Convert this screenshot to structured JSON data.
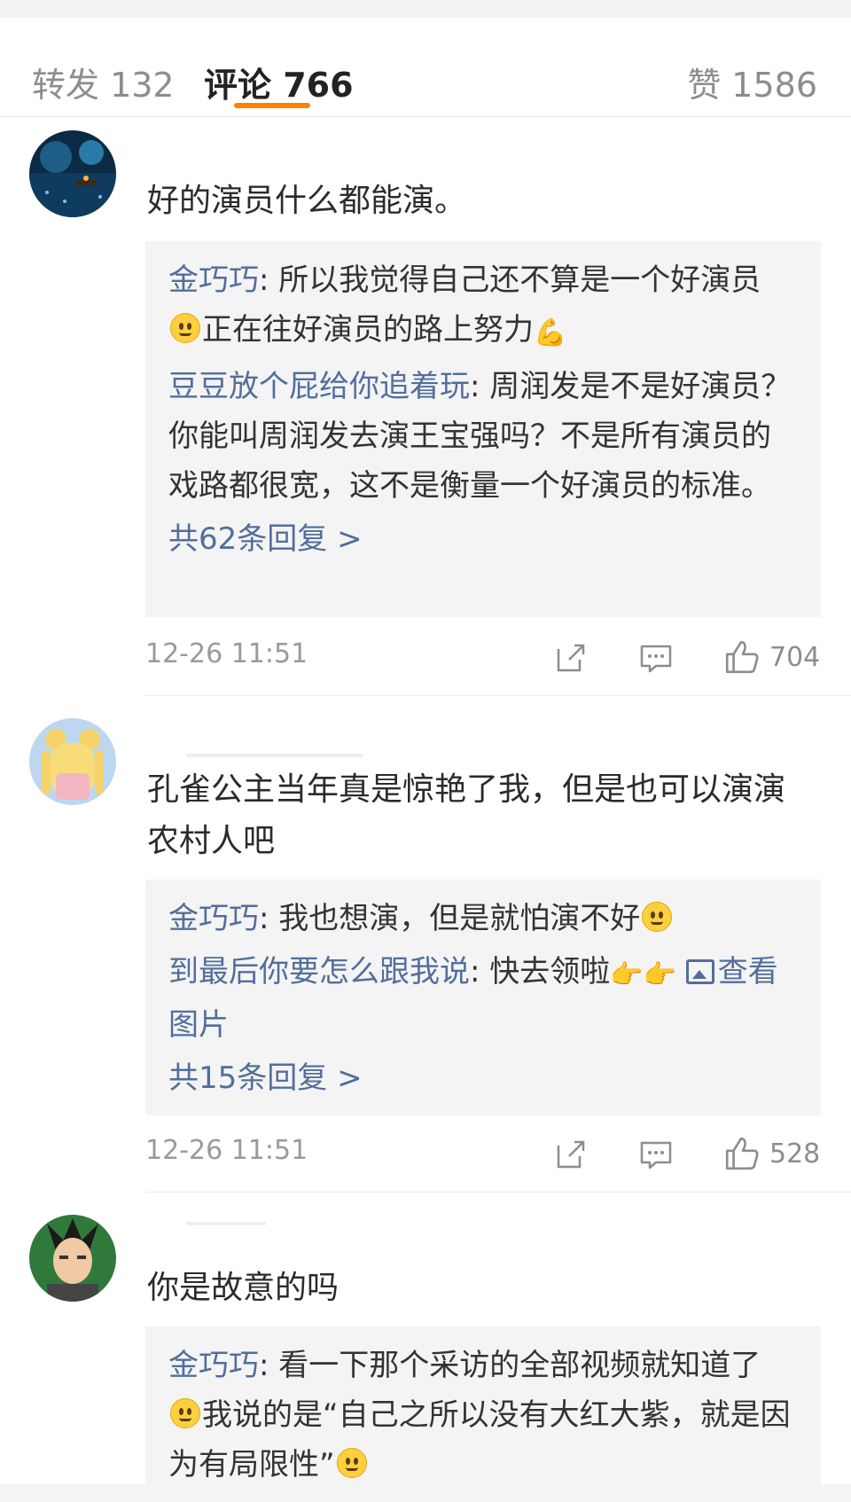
{
  "tabs": {
    "repost": "转发 132",
    "comments": "评论 766",
    "likes": "赞 1586"
  },
  "comments": [
    {
      "text": "好的演员什么都能演。",
      "replies": [
        {
          "name": "金巧巧",
          "sep": ": ",
          "text1": "所以我觉得自己还不算是一个好演员",
          "text2": "正在往好演员的路上努力"
        },
        {
          "name": "豆豆放个屁给你追着玩",
          "sep": ": ",
          "text": "周润发是不是好演员？你能叫周润发去演王宝强吗？不是所有演员的戏路都很宽，这不是衡量一个好演员的标准。"
        }
      ],
      "more": "共62条回复 >",
      "time": "12-26 11:51",
      "likes": "704"
    },
    {
      "text": "孔雀公主当年真是惊艳了我，但是也可以演演农村人吧",
      "replies": [
        {
          "name": "金巧巧",
          "sep": ": ",
          "text": "我也想演，但是就怕演不好"
        },
        {
          "name": "到最后你要怎么跟我说",
          "sep": ": ",
          "text": "快去领啦",
          "link": "查看图片"
        }
      ],
      "more": "共15条回复 >",
      "time": "12-26 11:51",
      "likes": "528"
    },
    {
      "text": "你是故意的吗",
      "replies": [
        {
          "name": "金巧巧",
          "sep": ": ",
          "text1": "看一下那个采访的全部视频就知道了",
          "text2": "我说的是“自己之所以没有大红大紫，就是因为有局限性”"
        }
      ]
    }
  ],
  "colors": {
    "accent": "#ff8200",
    "link": "#526e9c",
    "reply_bg": "#f4f4f4"
  },
  "icons": [
    "share-icon",
    "comment-icon",
    "like-icon",
    "smile-emoji",
    "flex-emoji",
    "laugh-emoji",
    "point-right-emoji",
    "image-icon"
  ]
}
